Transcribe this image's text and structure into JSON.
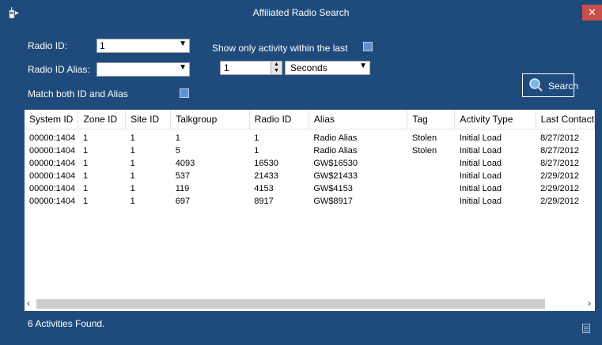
{
  "window": {
    "title": "Affiliated Radio Search",
    "close_glyph": "✕"
  },
  "form": {
    "radio_id_label": "Radio ID:",
    "radio_id_value": "1",
    "radio_alias_label": "Radio ID Alias:",
    "radio_alias_value": "",
    "match_both_label": "Match both ID and Alias",
    "show_only_label": "Show only activity within the last",
    "within_value": "1",
    "unit_value": "Seconds",
    "search_label": "Search"
  },
  "table": {
    "columns": [
      "System ID",
      "Zone ID",
      "Site ID",
      "Talkgroup",
      "Radio ID",
      "Alias",
      "Tag",
      "Activity Type",
      "Last Contact"
    ],
    "rows": [
      [
        "00000:1404",
        "1",
        "1",
        "1",
        "1",
        "Radio Alias",
        "Stolen",
        "Initial Load",
        "8/27/2012"
      ],
      [
        "00000:1404",
        "1",
        "1",
        "5",
        "1",
        "Radio Alias",
        "Stolen",
        "Initial Load",
        "8/27/2012"
      ],
      [
        "00000:1404",
        "1",
        "1",
        "4093",
        "16530",
        "GW$16530",
        "",
        "Initial Load",
        "8/27/2012"
      ],
      [
        "00000:1404",
        "1",
        "1",
        "537",
        "21433",
        "GW$21433",
        "",
        "Initial Load",
        "2/29/2012"
      ],
      [
        "00000:1404",
        "1",
        "1",
        "119",
        "4153",
        "GW$4153",
        "",
        "Initial Load",
        "2/29/2012"
      ],
      [
        "00000:1404",
        "1",
        "1",
        "697",
        "8917",
        "GW$8917",
        "",
        "Initial Load",
        "2/29/2012"
      ]
    ]
  },
  "status": {
    "text": "6 Activities Found."
  },
  "colors": {
    "background": "#1f4b7c",
    "checkbox": "#5e91d3",
    "close": "#c7504a"
  },
  "icons": {
    "app": "radio-icon",
    "search": "magnifier-icon",
    "status": "document-icon"
  }
}
